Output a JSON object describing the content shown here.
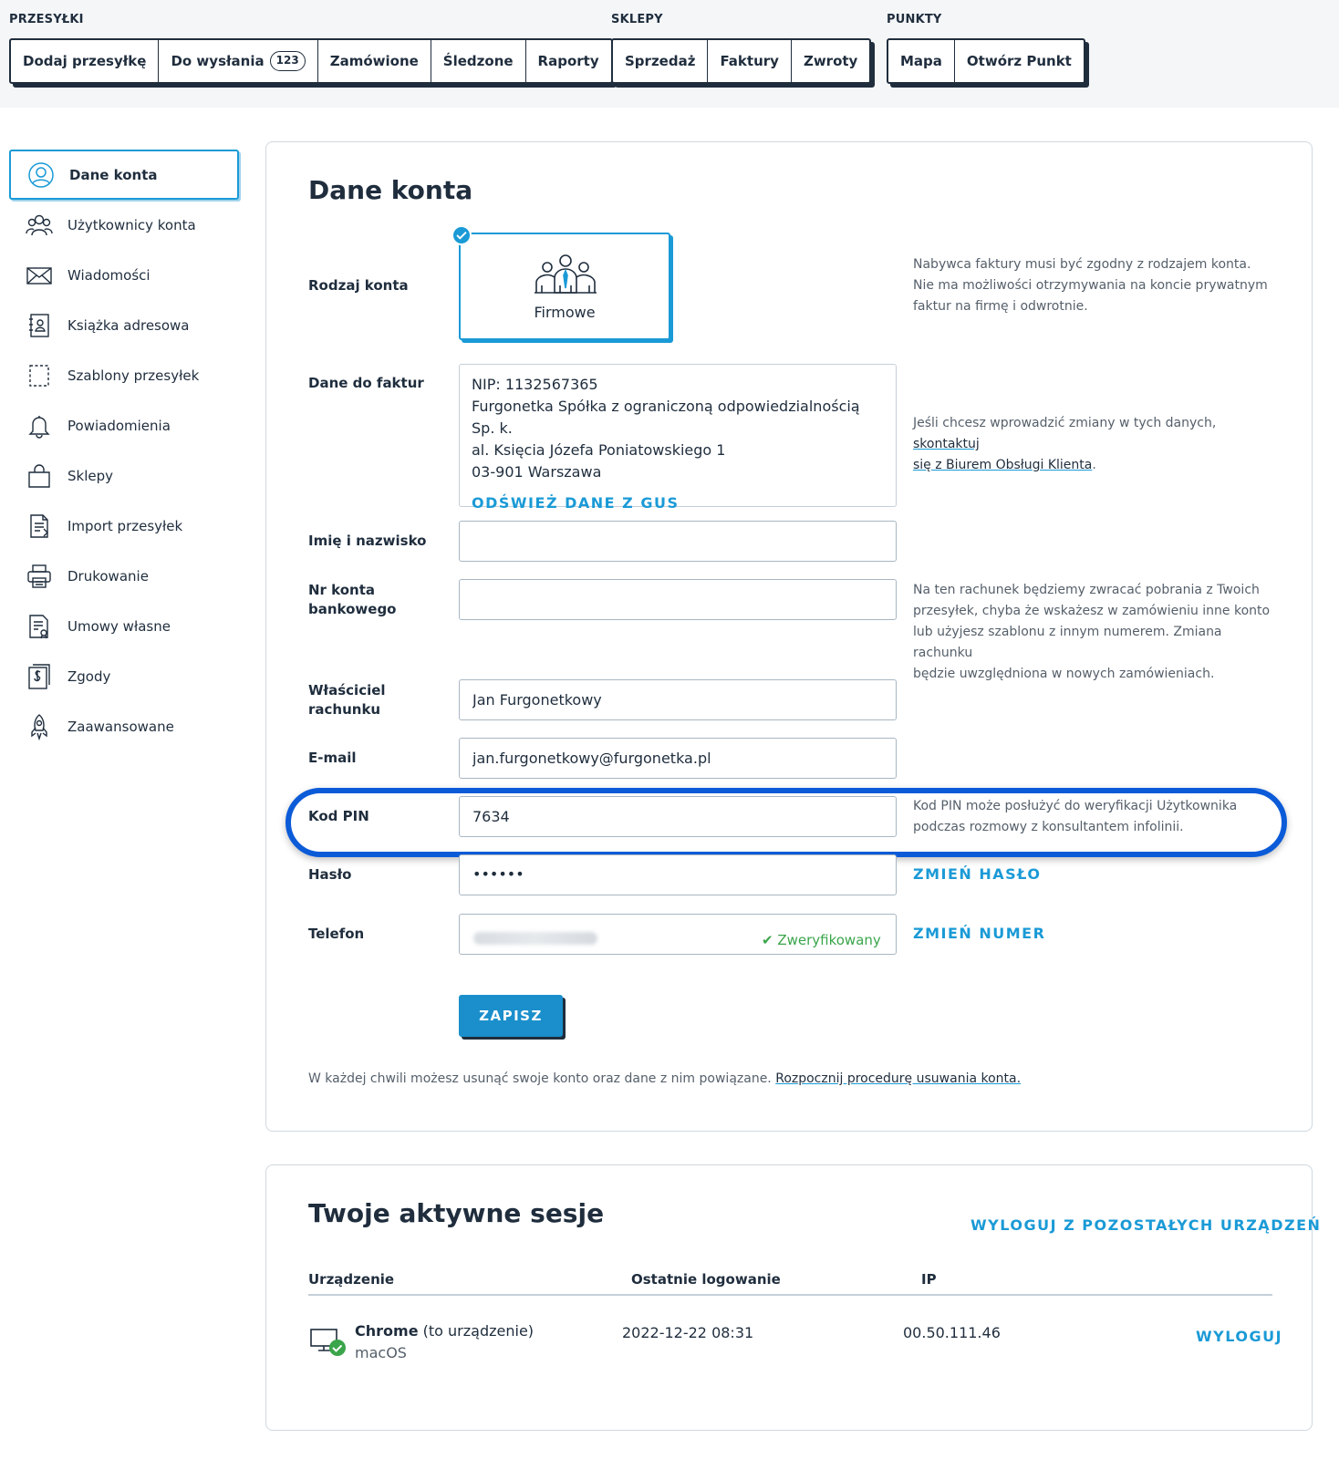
{
  "nav": {
    "groups": [
      {
        "title": "PRZESYŁKI",
        "items": [
          "Dodaj przesyłkę",
          "Do wysłania",
          "Zamówione",
          "Śledzone",
          "Raporty"
        ],
        "counter": "123"
      },
      {
        "title": "SKLEPY",
        "items": [
          "Sprzedaż",
          "Faktury",
          "Zwroty"
        ]
      },
      {
        "title": "PUNKTY",
        "items": [
          "Mapa",
          "Otwórz Punkt"
        ]
      }
    ]
  },
  "sidebar": {
    "items": [
      {
        "label": "Dane konta",
        "icon": "user-circle-icon"
      },
      {
        "label": "Użytkownicy konta",
        "icon": "users-icon"
      },
      {
        "label": "Wiadomości",
        "icon": "envelope-icon"
      },
      {
        "label": "Książka adresowa",
        "icon": "address-book-icon"
      },
      {
        "label": "Szablony przesyłek",
        "icon": "template-icon"
      },
      {
        "label": "Powiadomienia",
        "icon": "bell-icon"
      },
      {
        "label": "Sklepy",
        "icon": "shopping-bag-icon"
      },
      {
        "label": "Import przesyłek",
        "icon": "import-document-icon"
      },
      {
        "label": "Drukowanie",
        "icon": "printer-icon"
      },
      {
        "label": "Umowy własne",
        "icon": "contract-icon"
      },
      {
        "label": "Zgody",
        "icon": "consent-document-icon"
      },
      {
        "label": "Zaawansowane",
        "icon": "rocket-icon"
      }
    ]
  },
  "form": {
    "title": "Dane konta",
    "account_type": {
      "label": "Rodzaj konta",
      "card": "Firmowe",
      "help": [
        "Nabywca faktury musi być zgodny z rodzajem konta.",
        "Nie ma możliwości otrzymywania na koncie prywatnym",
        "faktur na firmę i odwrotnie."
      ]
    },
    "invoice": {
      "label": "Dane do faktur",
      "lines": [
        "NIP: 1132567365",
        "Furgonetka Spółka z ograniczoną odpowiedzialnością Sp. k.",
        "al. Księcia Józefa Poniatowskiego 1",
        "03-901 Warszawa"
      ],
      "refresh": "ODŚWIEŻ DANE Z GUS",
      "help_prefix": "Jeśli chcesz wprowadzić zmiany w tych danych, ",
      "help_link_1": "skontaktuj",
      "help_link_2": "się z Biurem Obsługi Klienta",
      "help_suffix": "."
    },
    "name": {
      "label": "Imię i nazwisko",
      "value": ""
    },
    "bank": {
      "label_1": "Nr konta",
      "label_2": "bankowego",
      "value": "",
      "help": [
        "Na ten rachunek będziemy zwracać pobrania z Twoich",
        "przesyłek, chyba że wskażesz w zamówieniu inne konto",
        "lub użyjesz szablonu z innym numerem. Zmiana rachunku",
        "będzie uwzględniona w nowych zamówieniach."
      ]
    },
    "owner": {
      "label_1": "Właściciel",
      "label_2": "rachunku",
      "value": "Jan Furgonetkowy"
    },
    "email": {
      "label": "E-mail",
      "value": "jan.furgonetkowy@furgonetka.pl"
    },
    "pin": {
      "label": "Kod PIN",
      "value": "7634",
      "help": [
        "Kod PIN może posłużyć do weryfikacji Użytkownika",
        "podczas rozmowy z konsultantem infolinii."
      ]
    },
    "password": {
      "label": "Hasło",
      "value": "••••••",
      "action": "ZMIEŃ HASŁO"
    },
    "phone": {
      "label": "Telefon",
      "verified": "✔ Zweryfikowany",
      "action": "ZMIEŃ NUMER"
    },
    "save": "ZAPISZ",
    "footer_text": "W każdej chwili możesz usunąć swoje konto oraz dane z nim powiązane. ",
    "footer_link": "Rozpocznij procedurę usuwania konta."
  },
  "sessions": {
    "title": "Twoje aktywne sesje",
    "logout_all": "WYLOGUJ Z POZOSTAŁYCH URZĄDZEŃ",
    "columns": [
      "Urządzenie",
      "Ostatnie logowanie",
      "IP"
    ],
    "rows": [
      {
        "browser": "Chrome",
        "note": "(to urządzenie)",
        "os": "macOS",
        "last_login": "2022-12-22 08:31",
        "ip": "00.50.111.46",
        "action": "WYLOGUJ"
      }
    ]
  },
  "colors": {
    "accent": "#1a9ad6",
    "text": "#1f2d3d",
    "highlight": "#0b5bd8",
    "verified": "#3aa54a"
  }
}
